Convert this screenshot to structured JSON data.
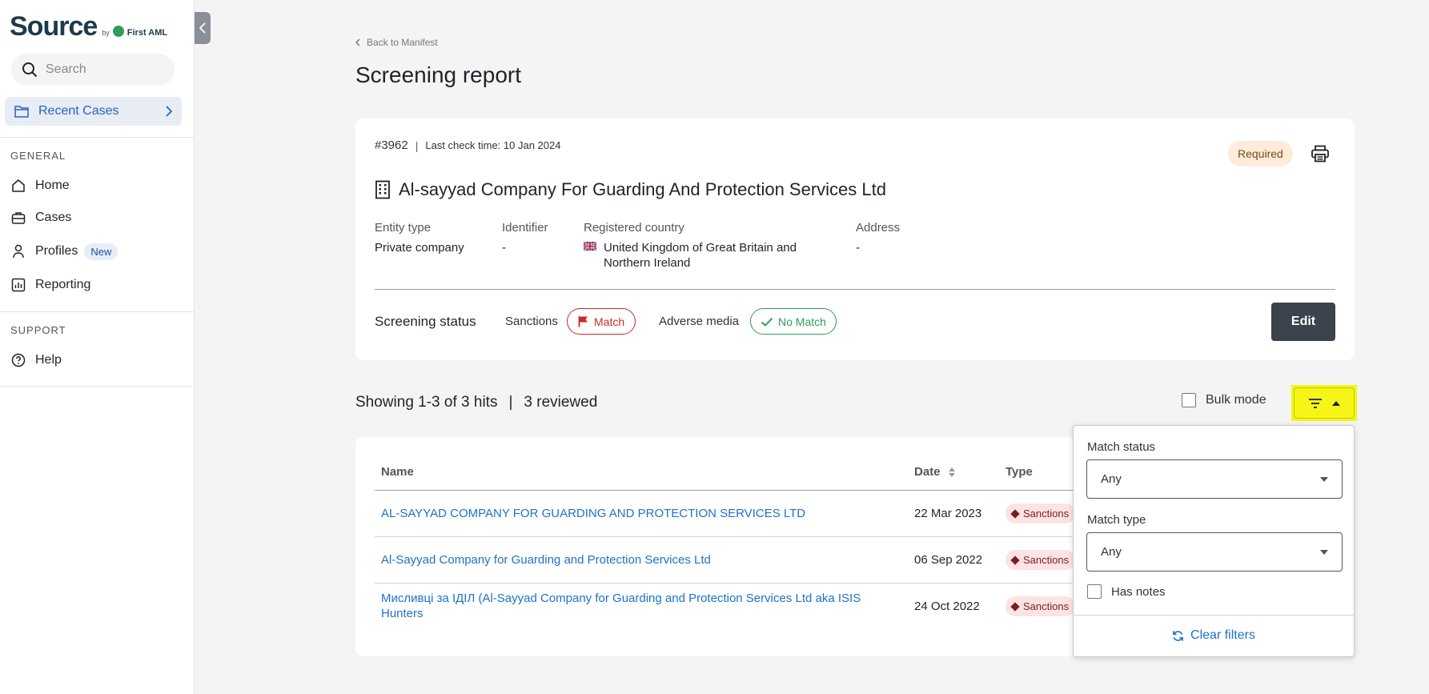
{
  "brand": {
    "name": "Source",
    "by": "by",
    "sub": "First AML"
  },
  "sidebar": {
    "search_placeholder": "Search",
    "recent_cases": "Recent Cases",
    "general_label": "GENERAL",
    "items": [
      {
        "label": "Home",
        "icon": "home-icon"
      },
      {
        "label": "Cases",
        "icon": "briefcase-icon"
      },
      {
        "label": "Profiles",
        "icon": "person-icon",
        "badge": "New"
      },
      {
        "label": "Reporting",
        "icon": "chart-icon"
      }
    ],
    "support_label": "SUPPORT",
    "help": "Help"
  },
  "main": {
    "back_link": "Back to Manifest",
    "title": "Screening report"
  },
  "entity": {
    "case_id": "#3962",
    "case_sep": "|",
    "last_check": "Last check time: 10 Jan 2024",
    "status_pill": "Required",
    "name": "Al-sayyad Company For Guarding And Protection Services Ltd",
    "fields": {
      "entity_type_label": "Entity type",
      "entity_type_value": "Private company",
      "identifier_label": "Identifier",
      "identifier_value": "-",
      "country_label": "Registered country",
      "country_value_line1": "United Kingdom of Great Britain and",
      "country_value_line2": "Northern Ireland",
      "address_label": "Address",
      "address_value": "-"
    },
    "screening_status_label": "Screening status",
    "sanctions_label": "Sanctions",
    "sanctions_status": "Match",
    "adverse_label": "Adverse media",
    "adverse_status": "No Match",
    "edit_label": "Edit",
    "colors": {
      "match": "#c92a2a",
      "no_match": "#2e9d5b",
      "required_bg": "#fdecd9"
    }
  },
  "hits": {
    "summary": "Showing 1-3 of 3 hits",
    "sep": "|",
    "reviewed": "3 reviewed",
    "bulk_mode": "Bulk mode",
    "columns": {
      "name": "Name",
      "date": "Date",
      "type": "Type"
    },
    "rows": [
      {
        "name": "AL-SAYYAD COMPANY FOR GUARDING AND PROTECTION SERVICES LTD",
        "date": "22 Mar 2023",
        "type": "Sanctions"
      },
      {
        "name": "Al-Sayyad Company for Guarding and Protection Services Ltd",
        "date": "06 Sep 2022",
        "type": "Sanctions"
      },
      {
        "name_line1": "Мисливці за ІДІЛ (Al-Sayyad Company for Guarding and Protection Services Ltd aka ISIS",
        "name_line2": "Hunters",
        "date": "24 Oct 2022",
        "type": "Sanctions"
      }
    ]
  },
  "filters": {
    "match_status_label": "Match status",
    "match_status_value": "Any",
    "match_type_label": "Match type",
    "match_type_value": "Any",
    "has_notes": "Has notes",
    "clear": "Clear filters",
    "highlight_color": "#f5f518"
  }
}
